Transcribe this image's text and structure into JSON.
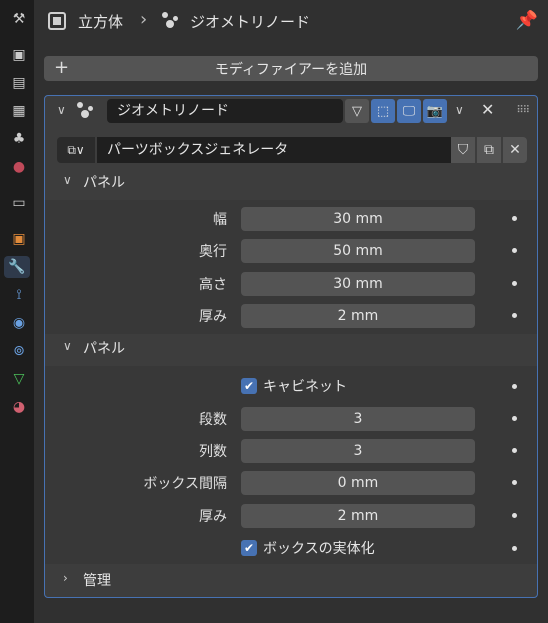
{
  "header": {
    "object_name": "立方体",
    "modifier_name": "ジオメトリノード",
    "pin_icon": "pin-icon"
  },
  "add_modifier": {
    "label": "モディファイアーを追加"
  },
  "modifier": {
    "name": "ジオメトリノード",
    "node_group": "パーツボックスジェネレータ"
  },
  "sections": [
    {
      "label": "パネル",
      "expanded": true,
      "fields": [
        {
          "label": "幅",
          "value": "30 mm"
        },
        {
          "label": "奥行",
          "value": "50 mm"
        },
        {
          "label": "高さ",
          "value": "30 mm"
        },
        {
          "label": "厚み",
          "value": "2 mm"
        }
      ]
    },
    {
      "label": "パネル",
      "expanded": true,
      "checkbox_top": {
        "label": "キャビネット",
        "checked": true
      },
      "fields": [
        {
          "label": "段数",
          "value": "3"
        },
        {
          "label": "列数",
          "value": "3"
        },
        {
          "label": "ボックス間隔",
          "value": "0 mm"
        },
        {
          "label": "厚み",
          "value": "2 mm"
        }
      ],
      "checkbox_bottom": {
        "label": "ボックスの実体化",
        "checked": true
      }
    },
    {
      "label": "管理",
      "expanded": false
    }
  ],
  "colors": {
    "accent": "#4772b3",
    "background": "#303030",
    "panel": "#3d3d3d",
    "field": "#545454"
  }
}
